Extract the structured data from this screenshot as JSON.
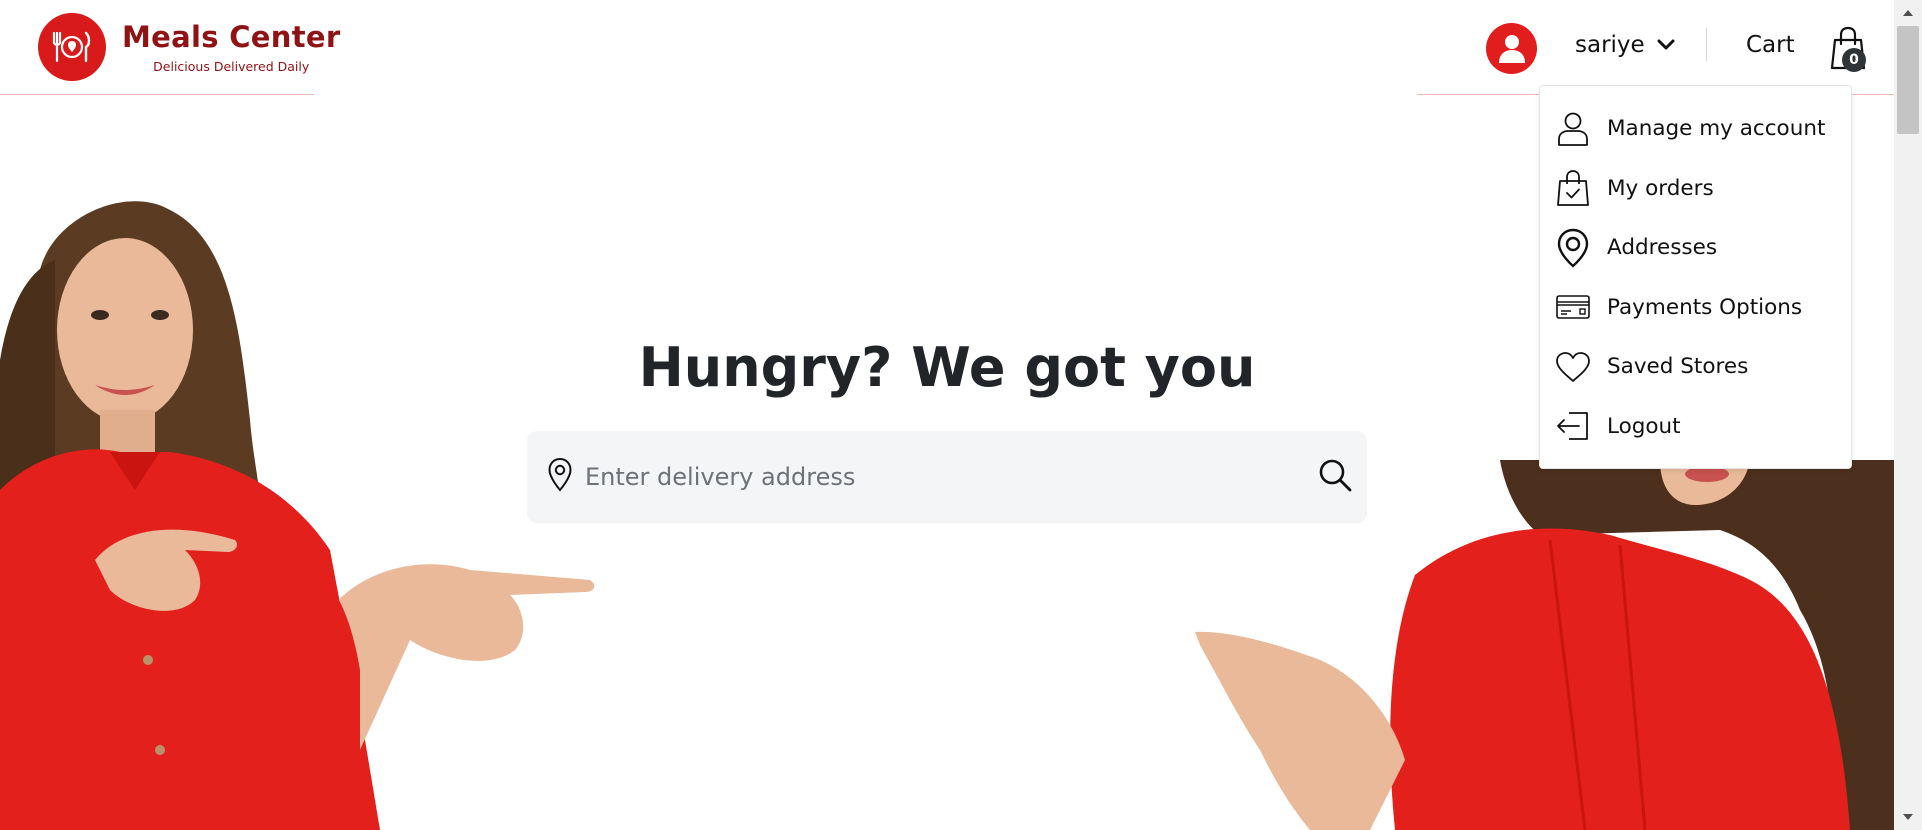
{
  "header": {
    "logo": {
      "title": "Meals Center",
      "tagline": "Delicious Delivered Daily"
    },
    "user": {
      "name": "sariye"
    },
    "cart": {
      "label": "Cart",
      "count": "0"
    }
  },
  "hero": {
    "title": "Hungry? We got you",
    "search": {
      "placeholder": "Enter delivery address",
      "value": ""
    }
  },
  "account_menu": {
    "items": [
      {
        "label": "Manage my account",
        "icon": "user-outline-icon"
      },
      {
        "label": "My orders",
        "icon": "shopping-bag-check-icon"
      },
      {
        "label": "Addresses",
        "icon": "map-pin-icon"
      },
      {
        "label": "Payments Options",
        "icon": "credit-card-icon"
      },
      {
        "label": "Saved Stores",
        "icon": "heart-icon"
      },
      {
        "label": "Logout",
        "icon": "logout-icon"
      }
    ]
  },
  "colors": {
    "brand_red": "#d81a1a",
    "brand_dark_red": "#8f1214",
    "badge_dark": "#2f3439",
    "search_bg": "#f4f5f7"
  }
}
